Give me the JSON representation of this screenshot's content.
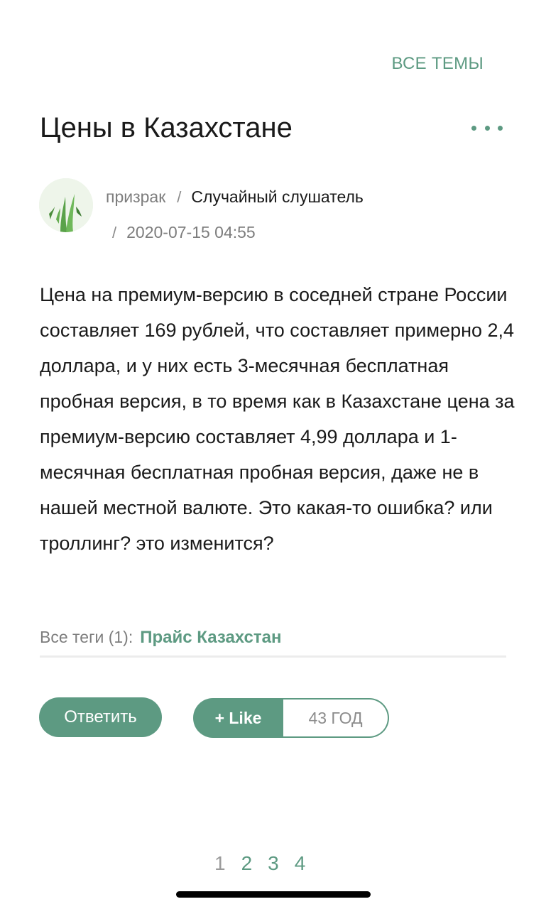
{
  "header": {
    "all_topics": "ВСЕ ТЕМЫ"
  },
  "post": {
    "title": "Цены в Казахстане",
    "author": "призрак",
    "separator": "/",
    "rank": "Случайный слушатель",
    "date": "2020-07-15 04:55",
    "body": "Цена на премиум-версию в соседней стране России составляет 169 рублей, что составляет примерно 2,4 доллара, и у них есть 3-месячная бесплатная пробная версия, в то время как в Казахстане цена за премиум-версию составляет 4,99 доллара и 1-месячная бесплатная пробная версия, даже не в нашей местной валюте. Это какая-то ошибка? или троллинг? это изменится?",
    "tags_label": "Все теги (1):",
    "tag": "Прайс Казахстан"
  },
  "actions": {
    "reply": "Ответить",
    "like": "+ Like",
    "like_count": "43 ГОД"
  },
  "pagination": [
    "1",
    "2",
    "3",
    "4"
  ],
  "colors": {
    "accent": "#5d9a82",
    "text": "#1a1a1a",
    "muted": "#7d7d7d"
  }
}
